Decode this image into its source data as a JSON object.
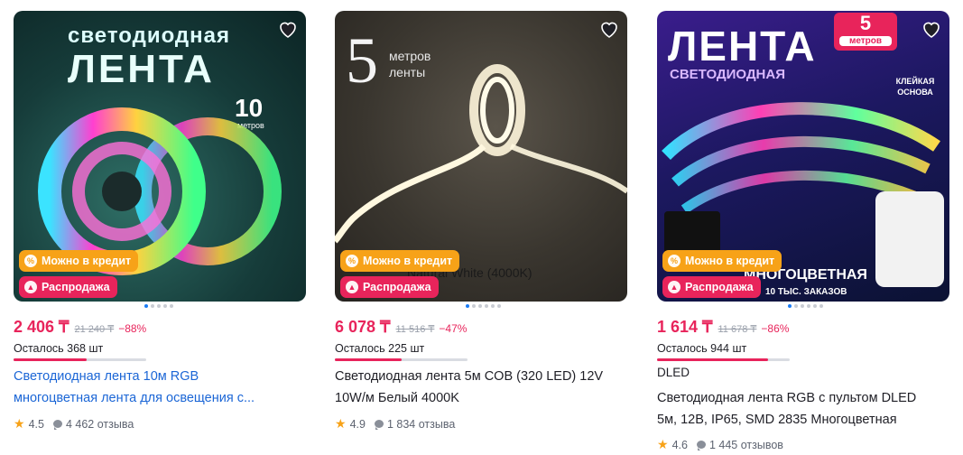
{
  "products": [
    {
      "image_text": {
        "line1": "светодиодная",
        "line2": "ЛЕНТА",
        "num": "10",
        "unit": "метров"
      },
      "badge_credit": "Можно в кредит",
      "badge_sale": "Распродажа",
      "price": "2 406 ₸",
      "old_price": "21 240 ₸",
      "discount": "−88%",
      "stock": "Осталось 368 шт",
      "stock_fraction": 0.55,
      "brand": "",
      "title_line1": "Светодиодная лента 10м RGB",
      "title_line2": "многоцветная лента для освещения с...",
      "rating": "4.5",
      "reviews": "4 462 отзыва",
      "carousel_active": 0
    },
    {
      "image_text": {
        "num": "5",
        "unit1": "метров",
        "unit2": "ленты",
        "caption": "Natural White (4000K)"
      },
      "badge_credit": "Можно в кредит",
      "badge_sale": "Распродажа",
      "price": "6 078 ₸",
      "old_price": "11 516 ₸",
      "discount": "−47%",
      "stock": "Осталось 225 шт",
      "stock_fraction": 0.5,
      "brand": "",
      "title_line1": "Светодиодная лента 5м COB (320 LED) 12V",
      "title_line2": "10W/м Белый 4000K",
      "rating": "4.9",
      "reviews": "1 834 отзыва",
      "carousel_active": 0
    },
    {
      "image_text": {
        "line1": "ЛЕНТА",
        "line2": "СВЕТОДИОДНАЯ",
        "num": "5",
        "unit": "метров",
        "note": "КЛЕЙКАЯ ОСНОВА",
        "bottom1": "МНОГОЦВЕТНАЯ",
        "bottom2": "10 ТЫС. ЗАКАЗОВ"
      },
      "badge_credit": "Можно в кредит",
      "badge_sale": "Распродажа",
      "price": "1 614 ₸",
      "old_price": "11 678 ₸",
      "discount": "−86%",
      "stock": "Осталось 944 шт",
      "stock_fraction": 0.84,
      "brand": "DLED",
      "title_line1": "Светодиодная лента RGB с пультом DLED",
      "title_line2": "5м, 12В, IP65, SMD 2835 Многоцветная",
      "rating": "4.6",
      "reviews": "1 445 отзывов",
      "carousel_active": 0
    }
  ]
}
